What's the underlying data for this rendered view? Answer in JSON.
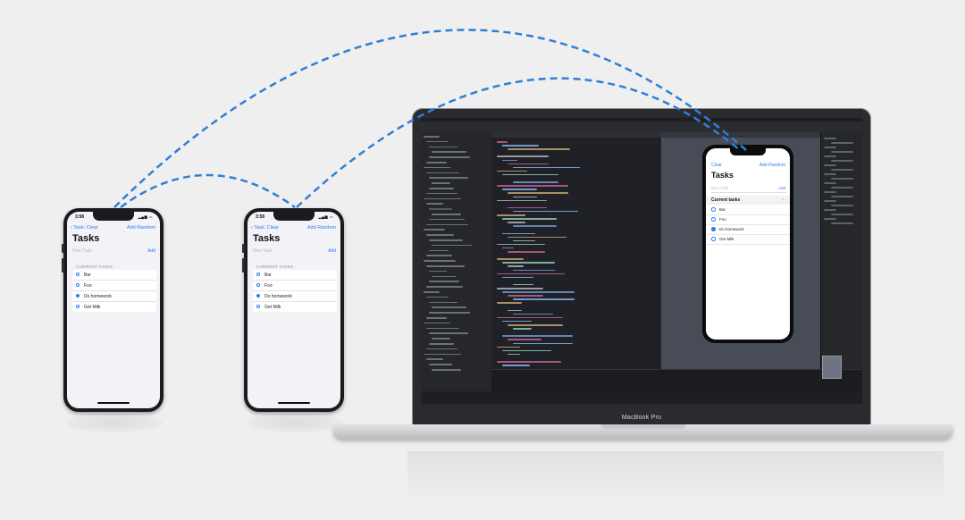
{
  "colors": {
    "accent": "#2f7cf6",
    "arc": "#2f7fd6",
    "background": "#efefef"
  },
  "phone_left": {
    "status_time": "3:58",
    "back_label": "Task: Clear",
    "add_random_label": "Add Random",
    "title": "Tasks",
    "new_task_placeholder": "New Task",
    "add_label": "Add",
    "section_header": "CURRENT TASKS",
    "tasks": [
      {
        "label": "Bar",
        "done": false
      },
      {
        "label": "Foo",
        "done": false
      },
      {
        "label": "Do homework",
        "done": true
      },
      {
        "label": "Get Milk",
        "done": false
      }
    ]
  },
  "phone_middle": {
    "status_time": "3:58",
    "back_label": "Task: Clear",
    "add_random_label": "Add Random",
    "title": "Tasks",
    "new_task_placeholder": "New Task",
    "add_label": "Add",
    "section_header": "CURRENT TASKS",
    "tasks": [
      {
        "label": "Bar",
        "done": false
      },
      {
        "label": "Foo",
        "done": false
      },
      {
        "label": "Do homework",
        "done": true
      },
      {
        "label": "Get Milk",
        "done": false
      }
    ]
  },
  "laptop": {
    "brand_label": "MacBook Pro",
    "simulator": {
      "clear_label": "Clear",
      "add_random_label": "Add Random",
      "title": "Tasks",
      "new_task_placeholder": "New Task",
      "add_label": "Add",
      "section_header": "Current tasks",
      "tasks": [
        {
          "label": "Bar",
          "done": false
        },
        {
          "label": "Foo",
          "done": false
        },
        {
          "label": "Do homework",
          "done": true
        },
        {
          "label": "Get Milk",
          "done": false
        }
      ]
    }
  }
}
